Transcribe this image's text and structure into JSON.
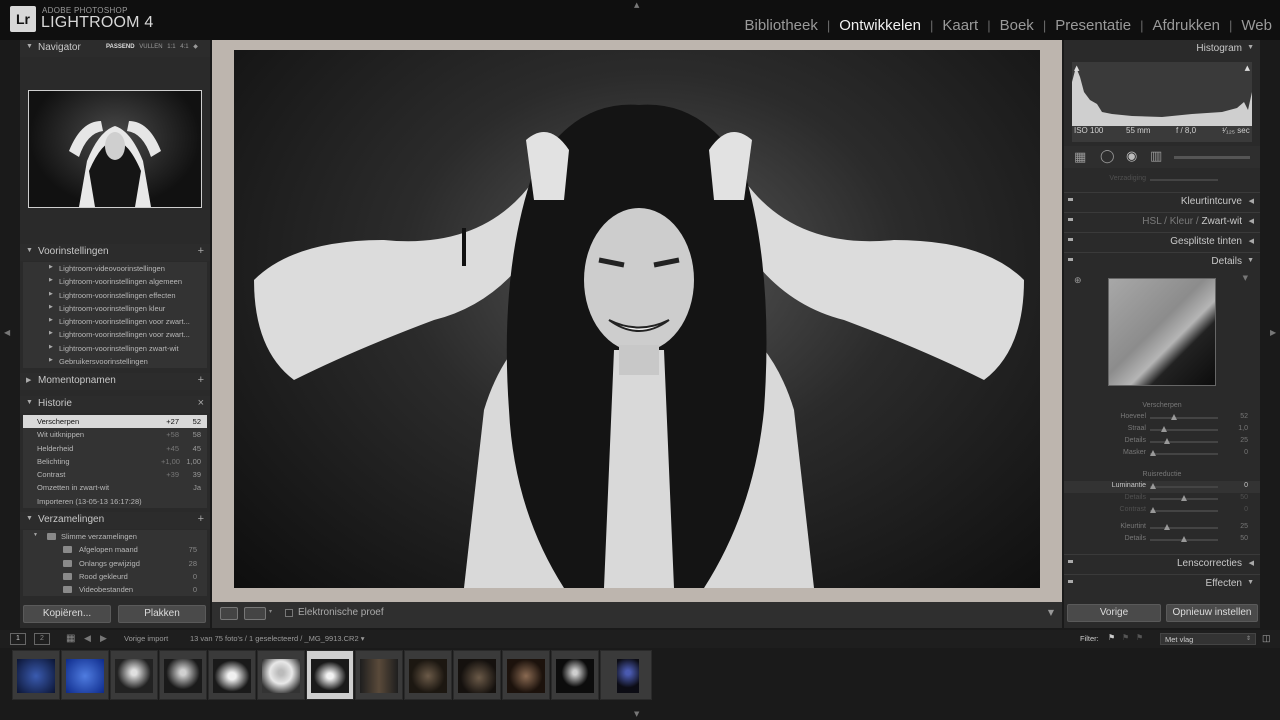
{
  "app": {
    "brand_small": "ADOBE PHOTOSHOP",
    "brand_large": "LIGHTROOM 4",
    "logo": "Lr",
    "modules": [
      "Bibliotheek",
      "Ontwikkelen",
      "Kaart",
      "Boek",
      "Presentatie",
      "Afdrukken",
      "Web"
    ],
    "active_module": "Ontwikkelen"
  },
  "left": {
    "navigator": {
      "title": "Navigator",
      "opt1": "PASSEND",
      "opt2": "VULLEN",
      "opt3": "1:1",
      "opt4": "4:1"
    },
    "presets": {
      "title": "Voorinstellingen",
      "items": [
        "Lightroom-videovoorinstellingen",
        "Lightroom-voorinstellingen algemeen",
        "Lightroom-voorinstellingen effecten",
        "Lightroom-voorinstellingen kleur",
        "Lightroom-voorinstellingen voor zwart...",
        "Lightroom-voorinstellingen voor zwart...",
        "Lightroom-voorinstellingen zwart-wit",
        "Gebruikersvoorinstellingen"
      ]
    },
    "snapshots": {
      "title": "Momentopnamen"
    },
    "history": {
      "title": "Historie",
      "items": [
        {
          "label": "Verscherpen",
          "v1": "+27",
          "v2": "52"
        },
        {
          "label": "Wit uitknippen",
          "v1": "+58",
          "v2": "58"
        },
        {
          "label": "Helderheid",
          "v1": "+45",
          "v2": "45"
        },
        {
          "label": "Belichting",
          "v1": "+1,00",
          "v2": "1,00"
        },
        {
          "label": "Contrast",
          "v1": "+39",
          "v2": "39"
        },
        {
          "label": "Omzetten in zwart-wit",
          "v1": "",
          "v2": "Ja"
        },
        {
          "label": "Importeren (13-05-13 16:17:28)",
          "v1": "",
          "v2": ""
        }
      ]
    },
    "collections": {
      "title": "Verzamelingen",
      "group": "Slimme verzamelingen",
      "items": [
        {
          "label": "Afgelopen maand",
          "count": "75"
        },
        {
          "label": "Onlangs gewijzigd",
          "count": "28"
        },
        {
          "label": "Rood gekleurd",
          "count": "0"
        },
        {
          "label": "Videobestanden",
          "count": "0"
        }
      ]
    },
    "copy_button": "Kopiëren...",
    "paste_button": "Plakken"
  },
  "toolbar": {
    "soft_proof_label": "Elektronische proef"
  },
  "right": {
    "histogram_title": "Histogram",
    "exif": {
      "iso": "ISO 100",
      "focal": "55 mm",
      "aperture": "f / 8,0",
      "shutter": "¹⁄₁₂₅ sec"
    },
    "partial_label": "Verzadiging",
    "sections": {
      "tone_curve": "Kleurtintcurve",
      "hsl": "HSL",
      "color": "Kleur",
      "bw": "Zwart-wit",
      "split": "Gesplitste tinten",
      "details": "Details",
      "lens": "Lenscorrecties",
      "effects": "Effecten"
    },
    "sharpening": {
      "title": "Verscherpen",
      "sliders": [
        {
          "label": "Hoeveel",
          "value": "52",
          "pos": 0.35
        },
        {
          "label": "Straal",
          "value": "1,0",
          "pos": 0.2
        },
        {
          "label": "Details",
          "value": "25",
          "pos": 0.25
        },
        {
          "label": "Masker",
          "value": "0",
          "pos": 0.05
        }
      ]
    },
    "noise": {
      "title": "Ruisreductie",
      "sliders": [
        {
          "label": "Luminantie",
          "value": "0",
          "pos": 0.05,
          "hl": true
        },
        {
          "label": "Details",
          "value": "50",
          "pos": 0.5,
          "faded": true
        },
        {
          "label": "Contrast",
          "value": "0",
          "pos": 0.05,
          "faded": true
        },
        {
          "label": "Kleurtint",
          "value": "25",
          "pos": 0.25
        },
        {
          "label": "Details",
          "value": "50",
          "pos": 0.5
        }
      ]
    },
    "prev_button": "Vorige",
    "reset_button": "Opnieuw instellen"
  },
  "filmstrip": {
    "page1": "1",
    "page2": "2",
    "source": "Vorige import",
    "info": "13 van 75 foto's / 1 geselecteerd / _MG_9913.CR2 ▾",
    "filter_label": "Filter:",
    "filter_value": "Met vlag"
  }
}
